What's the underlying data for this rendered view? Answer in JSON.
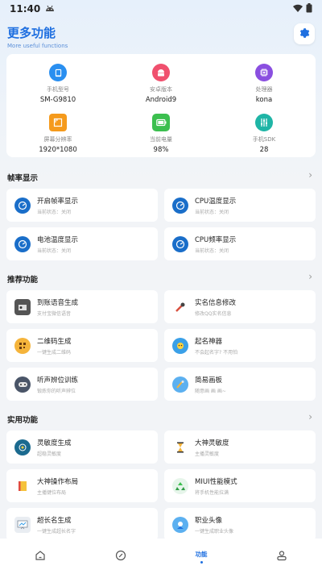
{
  "status_bar": {
    "time": "11:40"
  },
  "header": {
    "title": "更多功能",
    "subtitle": "More useful functions"
  },
  "device_info": [
    {
      "label": "手机型号",
      "value": "SM-G9810",
      "icon": "phone-icon",
      "color": "#2a8ff0"
    },
    {
      "label": "安卓版本",
      "value": "Android9",
      "icon": "android-icon",
      "color": "#f0506e"
    },
    {
      "label": "处理器",
      "value": "kona",
      "icon": "cpu-icon",
      "color": "#8a4fe0"
    },
    {
      "label": "屏幕分辨率",
      "value": "1920*1080",
      "icon": "screen-icon",
      "color": "#f59a1c"
    },
    {
      "label": "当前电量",
      "value": "98%",
      "icon": "battery-icon",
      "color": "#3cbf4f"
    },
    {
      "label": "手机SDK",
      "value": "28",
      "icon": "equalizer-icon",
      "color": "#1fb5a6"
    }
  ],
  "sections": {
    "fps": {
      "title": "帧率显示",
      "items": [
        {
          "title": "开启帧率显示",
          "sub": "当前状态：关闭"
        },
        {
          "title": "CPU温度显示",
          "sub": "当前状态：关闭"
        },
        {
          "title": "电池温度显示",
          "sub": "当前状态：关闭"
        },
        {
          "title": "CPU频率显示",
          "sub": "当前状态：关闭"
        }
      ]
    },
    "recommended": {
      "title": "推荐功能",
      "items": [
        {
          "title": "到账语音生成",
          "sub": "支付宝微信语音"
        },
        {
          "title": "实名信息修改",
          "sub": "修改QQ实名信息"
        },
        {
          "title": "二维码生成",
          "sub": "一键生成二维码"
        },
        {
          "title": "起名神器",
          "sub": "不会起名字? 不用怕"
        },
        {
          "title": "听声辨位训练",
          "sub": "锻炼你的听声辨位"
        },
        {
          "title": "简易画板",
          "sub": "随意画 画 画~"
        }
      ]
    },
    "practical": {
      "title": "实用功能",
      "items": [
        {
          "title": "灵敏度生成",
          "sub": "超稳灵敏度"
        },
        {
          "title": "大神灵敏度",
          "sub": "主播灵敏度"
        },
        {
          "title": "大神操作布局",
          "sub": "主播键位布局"
        },
        {
          "title": "MIUI性能模式",
          "sub": "将手机性能拉满"
        },
        {
          "title": "超长名生成",
          "sub": "一键生成超长名字"
        },
        {
          "title": "职业头像",
          "sub": "一键生成职业头像"
        }
      ]
    }
  },
  "bottom_nav": {
    "active_label": "功能"
  }
}
